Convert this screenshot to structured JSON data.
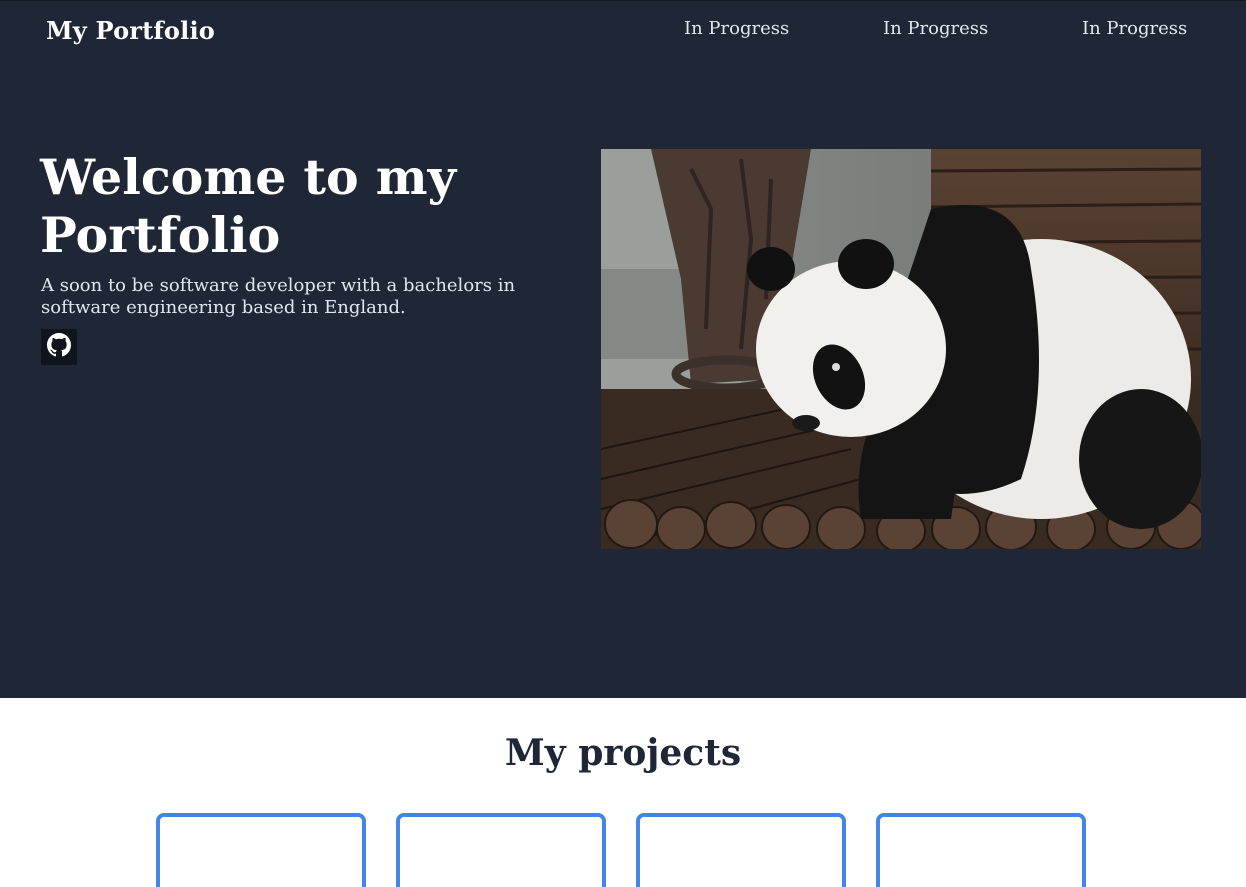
{
  "header": {
    "brand": "My Portfolio",
    "nav": [
      {
        "label": "In Progress"
      },
      {
        "label": "In Progress"
      },
      {
        "label": "In Progress"
      }
    ]
  },
  "hero": {
    "title": "Welcome to my Portfolio",
    "subtitle": "A soon to be software developer with a bachelors in software engineering based in England.",
    "github_icon": "github-icon",
    "image_subject": "panda"
  },
  "projects": {
    "title": "My projects",
    "cards": [
      {},
      {},
      {},
      {}
    ]
  },
  "colors": {
    "hero_background": "#1f2737",
    "card_border": "#4285e8",
    "heading_dark": "#1f2737"
  }
}
